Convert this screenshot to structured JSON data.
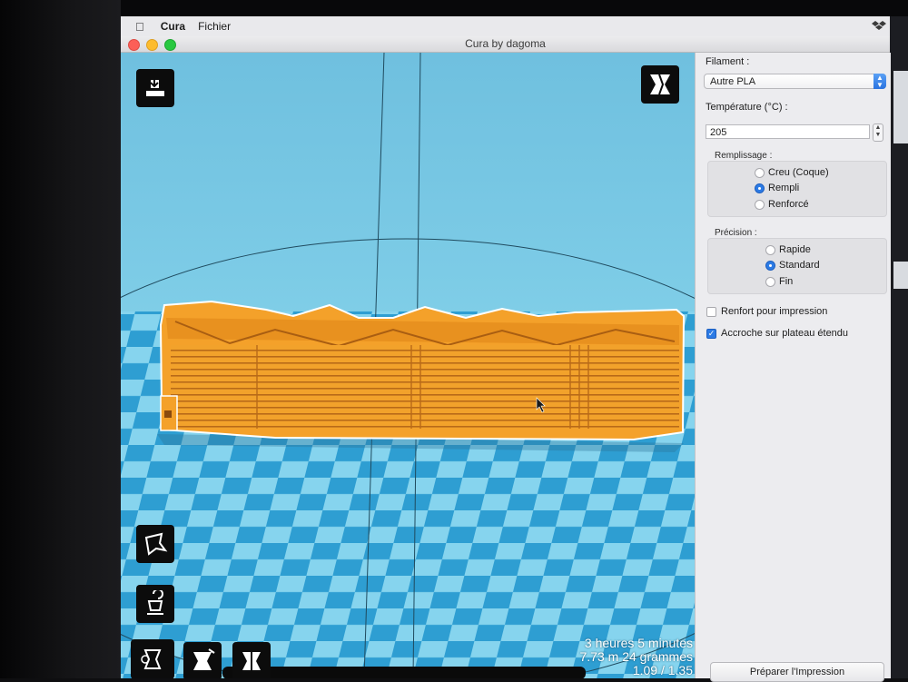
{
  "menubar": {
    "app_name": "Cura",
    "menu_file": "Fichier"
  },
  "window": {
    "title": "Cura by dagoma"
  },
  "viewport": {
    "stats": {
      "time": "3 heures 5 minutes",
      "material": "7.73 m 24 grammes",
      "ratio": "1.09 / 1.35"
    },
    "tools": [
      "load-model",
      "view-mode",
      "rotate",
      "lay-flat",
      "scale",
      "mirror",
      "split"
    ]
  },
  "panel": {
    "filament_label": "Filament :",
    "filament_value": "Autre PLA",
    "temperature_label": "Température (°C) :",
    "temperature_value": "205",
    "infill": {
      "title": "Remplissage :",
      "options": [
        "Creu (Coque)",
        "Rempli",
        "Renforcé"
      ],
      "selected": "Rempli"
    },
    "precision": {
      "title": "Précision :",
      "options": [
        "Rapide",
        "Standard",
        "Fin"
      ],
      "selected": "Standard"
    },
    "support_label": "Renfort pour impression",
    "support_checked": false,
    "brim_label": "Accroche sur plateau étendu",
    "brim_checked": true,
    "prepare_label": "Préparer l'Impression"
  },
  "colors": {
    "model": "#f4a12a",
    "model_shadow": "#c8731b",
    "bed_light": "#7fd0ec",
    "bed_dark": "#2d9cd0",
    "accent": "#2c7be5"
  }
}
